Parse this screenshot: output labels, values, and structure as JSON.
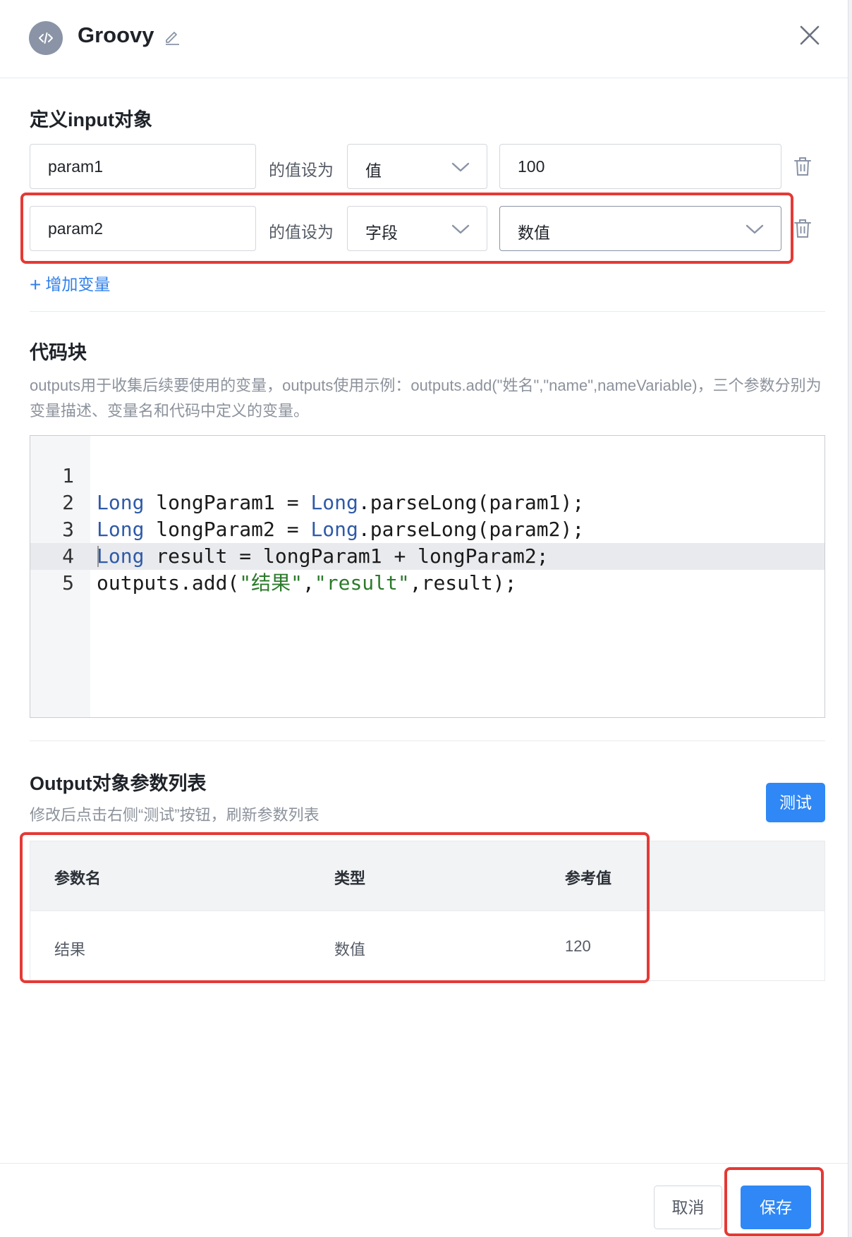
{
  "header": {
    "title": "Groovy",
    "icon": "code-icon"
  },
  "input_section": {
    "title": "定义input对象",
    "rows": [
      {
        "name": "param1",
        "connector": "的值设为",
        "type": "值",
        "value": "100",
        "value_is_select": false
      },
      {
        "name": "param2",
        "connector": "的值设为",
        "type": "字段",
        "value": "数值",
        "value_is_select": true
      }
    ],
    "add_label": "增加变量"
  },
  "code_section": {
    "title": "代码块",
    "description": "outputs用于收集后续要使用的变量，outputs使用示例：outputs.add(\"姓名\",\"name\",nameVariable)，三个参数分别为变量描述、变量名和代码中定义的变量。",
    "line_numbers": [
      "1",
      "2",
      "3",
      "4",
      "5"
    ],
    "lines": [
      "Long longParam1 = Long.parseLong(param1);",
      "Long longParam2 = Long.parseLong(param2);",
      "Long result = longParam1 + longParam2;",
      "outputs.add(\"结果\",\"result\",result);",
      ""
    ]
  },
  "output_section": {
    "title": "Output对象参数列表",
    "hint": "修改后点击右侧“测试”按钮，刷新参数列表",
    "test_button": "测试",
    "columns": [
      "参数名",
      "类型",
      "参考值"
    ],
    "rows": [
      {
        "name": "结果",
        "type": "数值",
        "value": "120"
      }
    ]
  },
  "footer": {
    "cancel": "取消",
    "save": "保存"
  },
  "colors": {
    "primary": "#2f88f5",
    "annotation": "#e53935",
    "link": "#2f80ed"
  }
}
